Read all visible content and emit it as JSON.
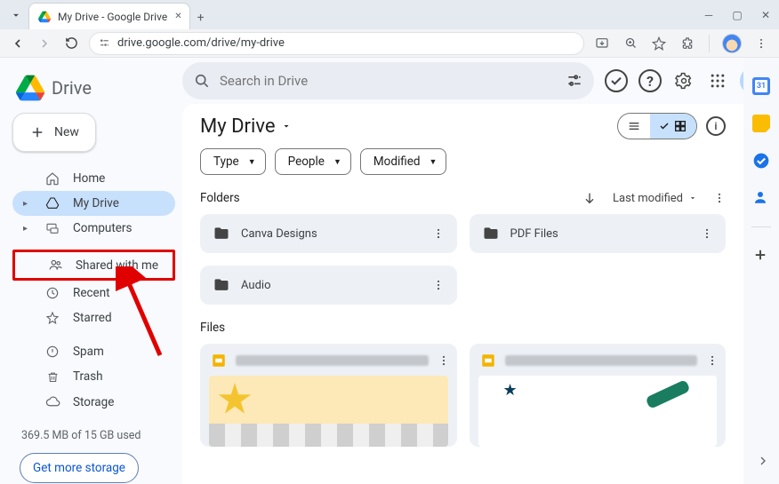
{
  "browser": {
    "tab_title": "My Drive - Google Drive",
    "url": "drive.google.com/drive/my-drive"
  },
  "app": {
    "brand": "Drive",
    "new_button": "New",
    "search_placeholder": "Search in Drive",
    "page_title": "My Drive",
    "section_folders": "Folders",
    "section_files": "Files",
    "sort_label": "Last modified",
    "chips": {
      "type": "Type",
      "people": "People",
      "modified": "Modified"
    },
    "storage_text": "369.5 MB of 15 GB used",
    "get_more": "Get more storage"
  },
  "nav": {
    "home": "Home",
    "my_drive": "My Drive",
    "computers": "Computers",
    "shared": "Shared with me",
    "recent": "Recent",
    "starred": "Starred",
    "spam": "Spam",
    "trash": "Trash",
    "storage": "Storage"
  },
  "folders": [
    {
      "name": "Canva Designs"
    },
    {
      "name": "PDF Files"
    },
    {
      "name": "Audio"
    }
  ],
  "files": [
    {
      "name_blur": "█████ ████ ███████ █",
      "type": "slides"
    },
    {
      "name_blur": "███████ ██ ███████ ██",
      "type": "slides"
    }
  ]
}
